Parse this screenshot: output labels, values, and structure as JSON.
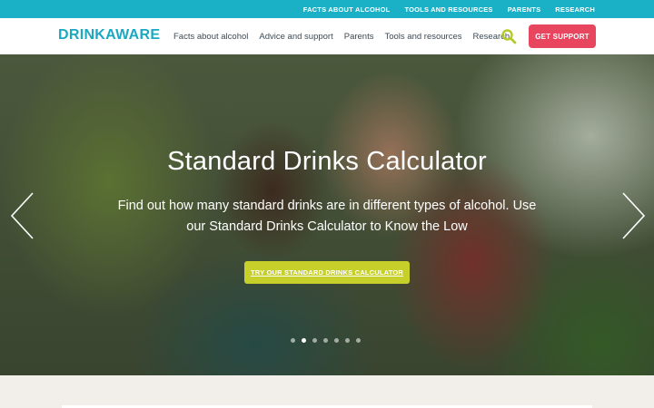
{
  "utility_nav": {
    "items": [
      {
        "label": "FACTS ABOUT ALCOHOL"
      },
      {
        "label": "TOOLS AND RESOURCES"
      },
      {
        "label": "PARENTS"
      },
      {
        "label": "RESEARCH"
      }
    ]
  },
  "header": {
    "logo": "DRINKAWARE",
    "nav": [
      {
        "label": "Facts about alcohol"
      },
      {
        "label": "Advice and support"
      },
      {
        "label": "Parents"
      },
      {
        "label": "Tools and resources"
      },
      {
        "label": "Research"
      }
    ],
    "search_icon": "search-icon",
    "cta_label": "GET SUPPORT"
  },
  "hero": {
    "title": "Standard Drinks Calculator",
    "description": "Find out how many standard drinks are in different types of alcohol. Use our Standard Drinks Calculator to Know the Low",
    "cta_label": "TRY OUR STANDARD DRINKS CALCULATOR",
    "prev_icon": "chevron-left-icon",
    "next_icon": "chevron-right-icon",
    "slide_count": 7,
    "active_slide": 2
  },
  "colors": {
    "brand_teal": "#1ab0c6",
    "support_pink": "#e8455e",
    "cta_lime": "#c7d02a",
    "search_lime": "#b6c92a"
  }
}
